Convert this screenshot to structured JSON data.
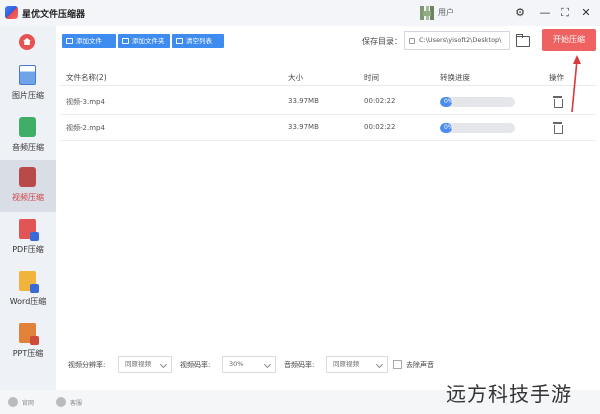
{
  "app": {
    "title": "星优文件压缩器",
    "user": "用户"
  },
  "sidebar": {
    "items": [
      {
        "label": "图片压缩",
        "icon": "image-file-icon"
      },
      {
        "label": "音频压缩",
        "icon": "audio-file-icon"
      },
      {
        "label": "视频压缩",
        "icon": "video-file-icon",
        "active": true
      },
      {
        "label": "PDF压缩",
        "icon": "pdf-file-icon"
      },
      {
        "label": "Word压缩",
        "icon": "word-file-icon"
      },
      {
        "label": "PPT压缩",
        "icon": "ppt-file-icon"
      }
    ]
  },
  "toolbar": {
    "add_file": "添加文件",
    "add_folder": "添加文件夹",
    "clear_list": "清空列表",
    "save_label": "保存目录：",
    "save_path": "C:\\Users\\yisoft2\\Desktop\\",
    "start_button": "开始压缩"
  },
  "table": {
    "headers": [
      "文件名称(2)",
      "大小",
      "时间",
      "转换进度",
      "操作"
    ],
    "rows": [
      {
        "name": "视频-3.mp4",
        "size": "33.97MB",
        "time": "00:02:22",
        "progress": "0%"
      },
      {
        "name": "视频-2.mp4",
        "size": "33.97MB",
        "time": "00:02:22",
        "progress": "0%"
      }
    ]
  },
  "settings": {
    "resolution_label": "视频分辨率:",
    "resolution_value": "同原视频",
    "bitrate_label": "视频码率:",
    "bitrate_value": "30%",
    "audio_bitrate_label": "音频码率:",
    "audio_bitrate_value": "同原视频",
    "remove_audio_label": "去除声音"
  },
  "footer": {
    "item1": "官网",
    "item2": "客服"
  },
  "watermark": "远方科技手游",
  "colors": {
    "accent": "#3f8cf0",
    "start": "#ef6262",
    "arrow": "#d93a3a"
  }
}
